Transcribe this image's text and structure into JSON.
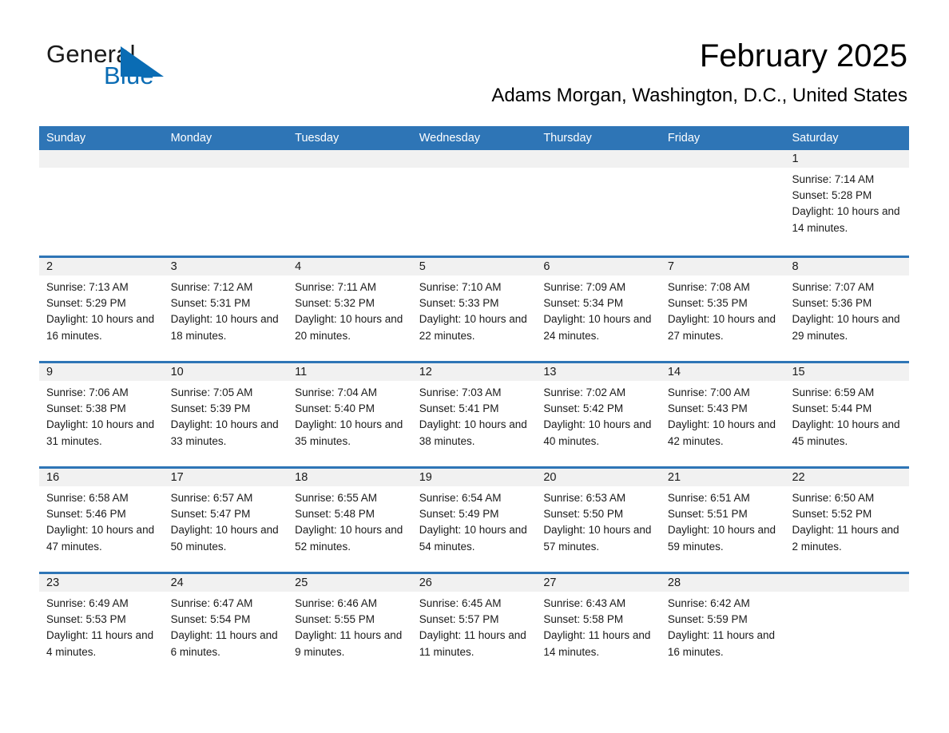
{
  "brand": {
    "word_general": "General",
    "word_blue": "Blue",
    "accent_color": "#2e75b6",
    "logo_blue_text_color": "#0a6cb4"
  },
  "header": {
    "month_title": "February 2025",
    "location": "Adams Morgan, Washington, D.C., United States"
  },
  "calendar": {
    "weekday_headers": [
      "Sunday",
      "Monday",
      "Tuesday",
      "Wednesday",
      "Thursday",
      "Friday",
      "Saturday"
    ],
    "labels": {
      "sunrise": "Sunrise:",
      "sunset": "Sunset:",
      "daylight": "Daylight:"
    },
    "weeks": [
      [
        {
          "day": "",
          "sunrise": "",
          "sunset": "",
          "daylight": ""
        },
        {
          "day": "",
          "sunrise": "",
          "sunset": "",
          "daylight": ""
        },
        {
          "day": "",
          "sunrise": "",
          "sunset": "",
          "daylight": ""
        },
        {
          "day": "",
          "sunrise": "",
          "sunset": "",
          "daylight": ""
        },
        {
          "day": "",
          "sunrise": "",
          "sunset": "",
          "daylight": ""
        },
        {
          "day": "",
          "sunrise": "",
          "sunset": "",
          "daylight": ""
        },
        {
          "day": "1",
          "sunrise": "Sunrise: 7:14 AM",
          "sunset": "Sunset: 5:28 PM",
          "daylight": "Daylight: 10 hours and 14 minutes."
        }
      ],
      [
        {
          "day": "2",
          "sunrise": "Sunrise: 7:13 AM",
          "sunset": "Sunset: 5:29 PM",
          "daylight": "Daylight: 10 hours and 16 minutes."
        },
        {
          "day": "3",
          "sunrise": "Sunrise: 7:12 AM",
          "sunset": "Sunset: 5:31 PM",
          "daylight": "Daylight: 10 hours and 18 minutes."
        },
        {
          "day": "4",
          "sunrise": "Sunrise: 7:11 AM",
          "sunset": "Sunset: 5:32 PM",
          "daylight": "Daylight: 10 hours and 20 minutes."
        },
        {
          "day": "5",
          "sunrise": "Sunrise: 7:10 AM",
          "sunset": "Sunset: 5:33 PM",
          "daylight": "Daylight: 10 hours and 22 minutes."
        },
        {
          "day": "6",
          "sunrise": "Sunrise: 7:09 AM",
          "sunset": "Sunset: 5:34 PM",
          "daylight": "Daylight: 10 hours and 24 minutes."
        },
        {
          "day": "7",
          "sunrise": "Sunrise: 7:08 AM",
          "sunset": "Sunset: 5:35 PM",
          "daylight": "Daylight: 10 hours and 27 minutes."
        },
        {
          "day": "8",
          "sunrise": "Sunrise: 7:07 AM",
          "sunset": "Sunset: 5:36 PM",
          "daylight": "Daylight: 10 hours and 29 minutes."
        }
      ],
      [
        {
          "day": "9",
          "sunrise": "Sunrise: 7:06 AM",
          "sunset": "Sunset: 5:38 PM",
          "daylight": "Daylight: 10 hours and 31 minutes."
        },
        {
          "day": "10",
          "sunrise": "Sunrise: 7:05 AM",
          "sunset": "Sunset: 5:39 PM",
          "daylight": "Daylight: 10 hours and 33 minutes."
        },
        {
          "day": "11",
          "sunrise": "Sunrise: 7:04 AM",
          "sunset": "Sunset: 5:40 PM",
          "daylight": "Daylight: 10 hours and 35 minutes."
        },
        {
          "day": "12",
          "sunrise": "Sunrise: 7:03 AM",
          "sunset": "Sunset: 5:41 PM",
          "daylight": "Daylight: 10 hours and 38 minutes."
        },
        {
          "day": "13",
          "sunrise": "Sunrise: 7:02 AM",
          "sunset": "Sunset: 5:42 PM",
          "daylight": "Daylight: 10 hours and 40 minutes."
        },
        {
          "day": "14",
          "sunrise": "Sunrise: 7:00 AM",
          "sunset": "Sunset: 5:43 PM",
          "daylight": "Daylight: 10 hours and 42 minutes."
        },
        {
          "day": "15",
          "sunrise": "Sunrise: 6:59 AM",
          "sunset": "Sunset: 5:44 PM",
          "daylight": "Daylight: 10 hours and 45 minutes."
        }
      ],
      [
        {
          "day": "16",
          "sunrise": "Sunrise: 6:58 AM",
          "sunset": "Sunset: 5:46 PM",
          "daylight": "Daylight: 10 hours and 47 minutes."
        },
        {
          "day": "17",
          "sunrise": "Sunrise: 6:57 AM",
          "sunset": "Sunset: 5:47 PM",
          "daylight": "Daylight: 10 hours and 50 minutes."
        },
        {
          "day": "18",
          "sunrise": "Sunrise: 6:55 AM",
          "sunset": "Sunset: 5:48 PM",
          "daylight": "Daylight: 10 hours and 52 minutes."
        },
        {
          "day": "19",
          "sunrise": "Sunrise: 6:54 AM",
          "sunset": "Sunset: 5:49 PM",
          "daylight": "Daylight: 10 hours and 54 minutes."
        },
        {
          "day": "20",
          "sunrise": "Sunrise: 6:53 AM",
          "sunset": "Sunset: 5:50 PM",
          "daylight": "Daylight: 10 hours and 57 minutes."
        },
        {
          "day": "21",
          "sunrise": "Sunrise: 6:51 AM",
          "sunset": "Sunset: 5:51 PM",
          "daylight": "Daylight: 10 hours and 59 minutes."
        },
        {
          "day": "22",
          "sunrise": "Sunrise: 6:50 AM",
          "sunset": "Sunset: 5:52 PM",
          "daylight": "Daylight: 11 hours and 2 minutes."
        }
      ],
      [
        {
          "day": "23",
          "sunrise": "Sunrise: 6:49 AM",
          "sunset": "Sunset: 5:53 PM",
          "daylight": "Daylight: 11 hours and 4 minutes."
        },
        {
          "day": "24",
          "sunrise": "Sunrise: 6:47 AM",
          "sunset": "Sunset: 5:54 PM",
          "daylight": "Daylight: 11 hours and 6 minutes."
        },
        {
          "day": "25",
          "sunrise": "Sunrise: 6:46 AM",
          "sunset": "Sunset: 5:55 PM",
          "daylight": "Daylight: 11 hours and 9 minutes."
        },
        {
          "day": "26",
          "sunrise": "Sunrise: 6:45 AM",
          "sunset": "Sunset: 5:57 PM",
          "daylight": "Daylight: 11 hours and 11 minutes."
        },
        {
          "day": "27",
          "sunrise": "Sunrise: 6:43 AM",
          "sunset": "Sunset: 5:58 PM",
          "daylight": "Daylight: 11 hours and 14 minutes."
        },
        {
          "day": "28",
          "sunrise": "Sunrise: 6:42 AM",
          "sunset": "Sunset: 5:59 PM",
          "daylight": "Daylight: 11 hours and 16 minutes."
        },
        {
          "day": "",
          "sunrise": "",
          "sunset": "",
          "daylight": ""
        }
      ]
    ]
  }
}
